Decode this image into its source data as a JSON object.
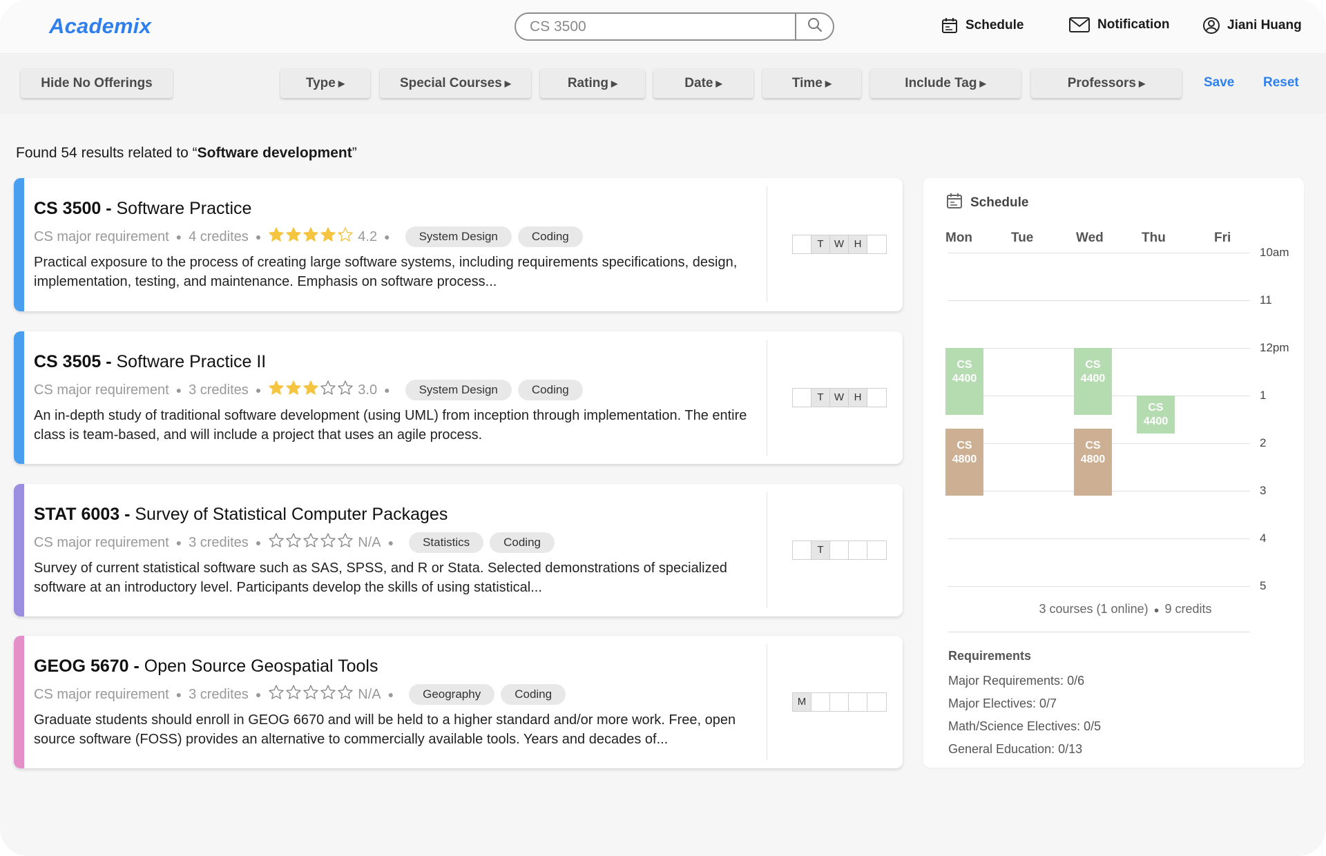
{
  "app": {
    "logo": "Academix"
  },
  "header": {
    "search_value": "CS 3500",
    "schedule_label": "Schedule",
    "notification_label": "Notification",
    "user_name": "Jiani Huang"
  },
  "filters": {
    "hide_no_offerings": "Hide No Offerings",
    "type": "Type",
    "special_courses": "Special Courses",
    "rating": "Rating",
    "date": "Date",
    "time": "Time",
    "include_tag": "Include Tag",
    "professors": "Professors",
    "save": "Save",
    "reset": "Reset"
  },
  "results": {
    "prefix": "Found 54 results related to “",
    "query": "Software development",
    "suffix": "”"
  },
  "courses": [
    {
      "code": "CS 3500 -",
      "name": " Software Practice",
      "requirement": "CS major requirement",
      "credits": "4 credites",
      "rating": 4.2,
      "rating_text": "4.2",
      "tags": [
        "System Design",
        "Coding"
      ],
      "description": "Practical exposure to the process of creating large software systems, including requirements specifications, design, implementation, testing, and maintenance. Emphasis on software process...",
      "accent": "#4a9ef0",
      "days": [
        "",
        "T",
        "W",
        "H",
        ""
      ]
    },
    {
      "code": "CS 3505 -",
      "name": " Software Practice II",
      "requirement": "CS major requirement",
      "credits": "3 credites",
      "rating": 3.0,
      "rating_text": "3.0",
      "tags": [
        "System Design",
        "Coding"
      ],
      "description": "An in-depth study of traditional software development (using UML) from inception through implementation. The entire class is team-based, and will include a project that uses an agile process.",
      "accent": "#4a9ef0",
      "days": [
        "",
        "T",
        "W",
        "H",
        ""
      ]
    },
    {
      "code": "STAT 6003 -",
      "name": " Survey of Statistical Computer Packages",
      "requirement": "CS major requirement",
      "credits": "3 credites",
      "rating": 0,
      "rating_text": "N/A",
      "tags": [
        "Statistics",
        "Coding"
      ],
      "description": "Survey of current statistical software such as SAS, SPSS, and R or Stata. Selected demonstrations of specialized software at an introductory level. Participants develop the skills of using statistical...",
      "accent": "#9b8ee0",
      "days": [
        "",
        "T",
        "",
        "",
        ""
      ]
    },
    {
      "code": "GEOG 5670 -",
      "name": " Open Source Geospatial Tools",
      "requirement": "CS major requirement",
      "credits": "3 credites",
      "rating": 0,
      "rating_text": "N/A",
      "tags": [
        "Geography",
        "Coding"
      ],
      "description": "Graduate students should enroll in GEOG 6670 and will be held to a higher standard and/or more work. Free, open source software (FOSS) provides an alternative to commercially available tools. Years and decades of...",
      "accent": "#e58fc9",
      "days": [
        "M",
        "",
        "",
        "",
        ""
      ]
    }
  ],
  "schedule": {
    "title": "Schedule",
    "days": [
      "Mon",
      "Tue",
      "Wed",
      "Thu",
      "Fri"
    ],
    "times": [
      "10am",
      "11",
      "12pm",
      "1",
      "2",
      "3",
      "4",
      "5"
    ],
    "blocks": [
      {
        "course": "CS 4400",
        "day": "Mon",
        "start": 12.0,
        "end": 13.4,
        "color": "green"
      },
      {
        "course": "CS 4400",
        "day": "Wed",
        "start": 12.0,
        "end": 13.4,
        "color": "green"
      },
      {
        "course": "CS 4400",
        "day": "Thu",
        "start": 13.0,
        "end": 13.8,
        "color": "green"
      },
      {
        "course": "CS 4800",
        "day": "Mon",
        "start": 13.7,
        "end": 15.1,
        "color": "tan"
      },
      {
        "course": "CS 4800",
        "day": "Wed",
        "start": 13.7,
        "end": 15.1,
        "color": "tan"
      }
    ],
    "summary_courses": "3 courses (1 online)",
    "summary_credits": "9 credits",
    "requirements_title": "Requirements",
    "requirements": [
      "Major Requirements: 0/6",
      "Major Electives: 0/7",
      "Math/Science Electives: 0/5",
      "General Education: 0/13"
    ]
  },
  "colors": {
    "brand": "#2f80ed",
    "star": "#f5c542",
    "block_green": "#b5dcb1",
    "block_tan": "#cdb094"
  }
}
